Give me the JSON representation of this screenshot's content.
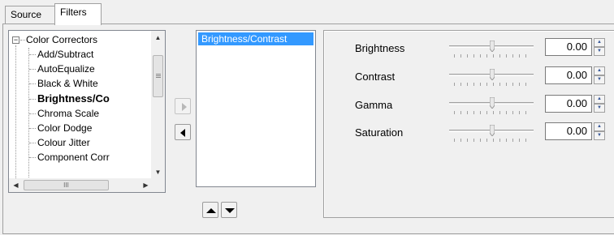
{
  "tabs": [
    {
      "label": "Source",
      "active": false
    },
    {
      "label": "Filters",
      "active": true
    }
  ],
  "tree": {
    "category": "Color Correctors",
    "expander_symbol": "−",
    "items": [
      {
        "label": "Add/Subtract",
        "selected": false
      },
      {
        "label": "AutoEqualize",
        "selected": false
      },
      {
        "label": "Black & White",
        "selected": false
      },
      {
        "label": "Brightness/Co",
        "selected": true
      },
      {
        "label": "Chroma Scale",
        "selected": false
      },
      {
        "label": "Color Dodge",
        "selected": false
      },
      {
        "label": "Colour Jitter",
        "selected": false
      },
      {
        "label": "Component Corr",
        "selected": false
      }
    ],
    "hscroll_thumb_label": "III"
  },
  "active_filters": [
    "Brightness/Contrast"
  ],
  "parameters": [
    {
      "label": "Brightness",
      "value": "0.00"
    },
    {
      "label": "Contrast",
      "value": "0.00"
    },
    {
      "label": "Gamma",
      "value": "0.00"
    },
    {
      "label": "Saturation",
      "value": "0.00"
    }
  ],
  "colors": {
    "selection": "#3399ff",
    "panel_bg": "#f0f0f0"
  }
}
